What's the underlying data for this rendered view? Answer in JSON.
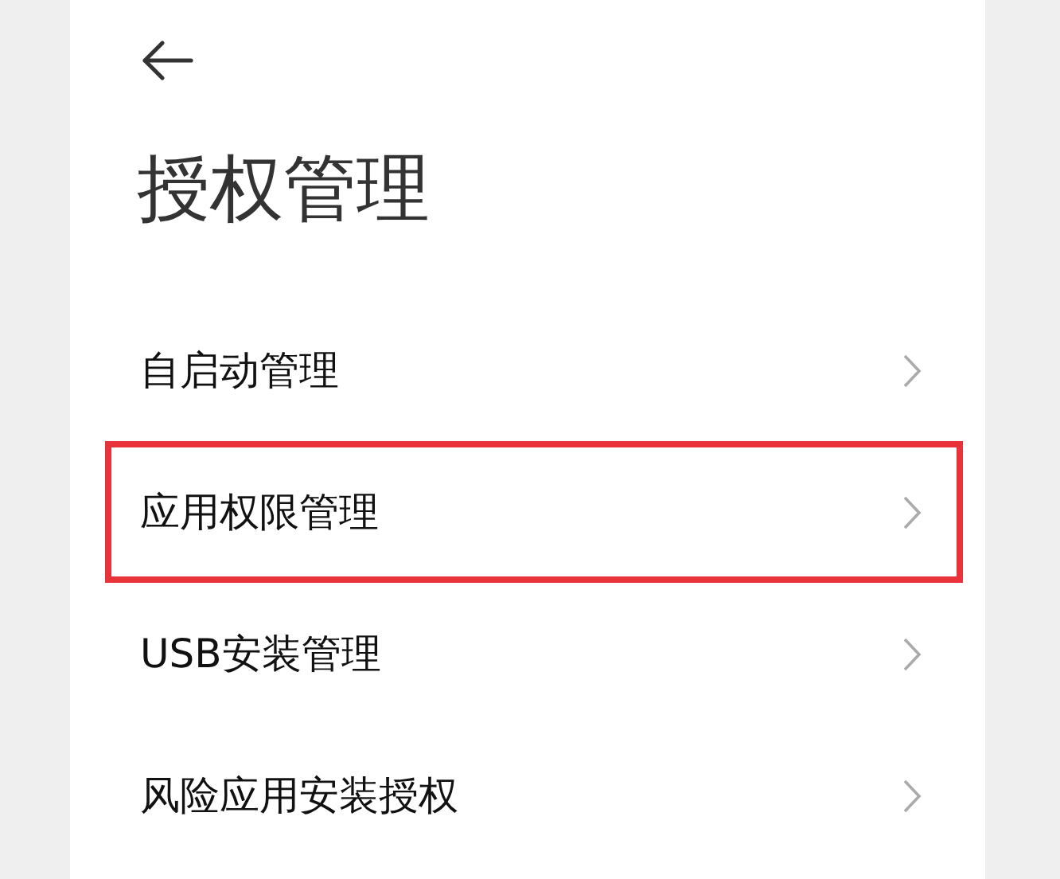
{
  "header": {
    "title": "授权管理"
  },
  "items": [
    {
      "label": "自启动管理",
      "highlighted": false
    },
    {
      "label": "应用权限管理",
      "highlighted": true
    },
    {
      "label": "USB安装管理",
      "highlighted": false
    },
    {
      "label": "风险应用安装授权",
      "highlighted": false
    }
  ]
}
